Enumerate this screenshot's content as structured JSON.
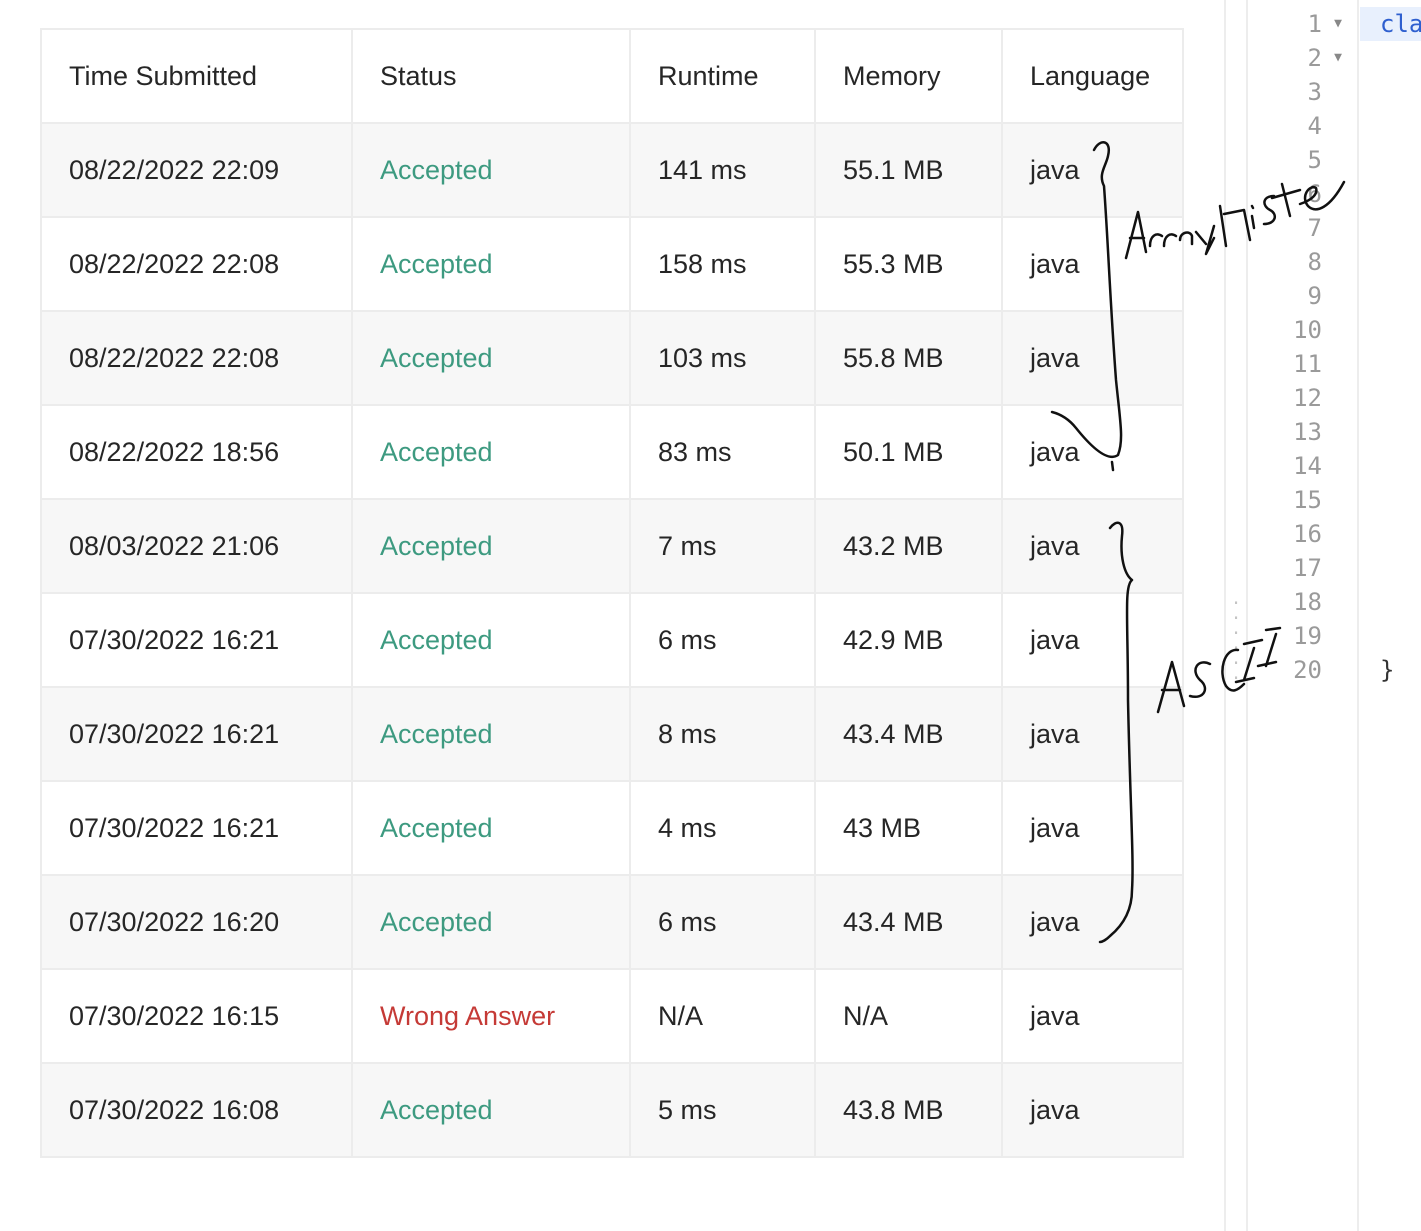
{
  "table": {
    "headers": [
      "Time Submitted",
      "Status",
      "Runtime",
      "Memory",
      "Language"
    ],
    "rows": [
      {
        "time": "08/22/2022 22:09",
        "status": "Accepted",
        "runtime": "141 ms",
        "memory": "55.1 MB",
        "language": "java"
      },
      {
        "time": "08/22/2022 22:08",
        "status": "Accepted",
        "runtime": "158 ms",
        "memory": "55.3 MB",
        "language": "java"
      },
      {
        "time": "08/22/2022 22:08",
        "status": "Accepted",
        "runtime": "103 ms",
        "memory": "55.8 MB",
        "language": "java"
      },
      {
        "time": "08/22/2022 18:56",
        "status": "Accepted",
        "runtime": "83 ms",
        "memory": "50.1 MB",
        "language": "java"
      },
      {
        "time": "08/03/2022 21:06",
        "status": "Accepted",
        "runtime": "7 ms",
        "memory": "43.2 MB",
        "language": "java"
      },
      {
        "time": "07/30/2022 16:21",
        "status": "Accepted",
        "runtime": "6 ms",
        "memory": "42.9 MB",
        "language": "java"
      },
      {
        "time": "07/30/2022 16:21",
        "status": "Accepted",
        "runtime": "8 ms",
        "memory": "43.4 MB",
        "language": "java"
      },
      {
        "time": "07/30/2022 16:21",
        "status": "Accepted",
        "runtime": "4 ms",
        "memory": "43 MB",
        "language": "java"
      },
      {
        "time": "07/30/2022 16:20",
        "status": "Accepted",
        "runtime": "6 ms",
        "memory": "43.4 MB",
        "language": "java"
      },
      {
        "time": "07/30/2022 16:15",
        "status": "Wrong Answer",
        "runtime": "N/A",
        "memory": "N/A",
        "language": "java"
      },
      {
        "time": "07/30/2022 16:08",
        "status": "Accepted",
        "runtime": "5 ms",
        "memory": "43.8 MB",
        "language": "java"
      }
    ]
  },
  "colors": {
    "accepted": "#3d9a80",
    "wrong_answer": "#c53a36",
    "header_text": "#262626",
    "row_alt_bg": "#f7f7f7",
    "ink": "#111111"
  },
  "editor": {
    "line_numbers": [
      "1",
      "2",
      "3",
      "4",
      "5",
      "6",
      "7",
      "8",
      "9",
      "10",
      "11",
      "12",
      "13",
      "14",
      "15",
      "16",
      "17",
      "18",
      "19",
      "20"
    ],
    "fold_lines": [
      "1",
      "2"
    ],
    "first_line_code": "class Solution {",
    "last_line_code": "}"
  },
  "annotations": {
    "upper_note": "ArrayList",
    "lower_note": "ASCII"
  }
}
